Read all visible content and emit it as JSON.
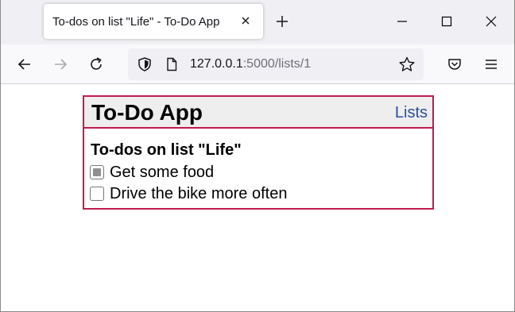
{
  "browser": {
    "tab_title": "To-dos on list \"Life\" - To-Do App",
    "url_host": "127.0.0.1",
    "url_path": ":5000/lists/1"
  },
  "app": {
    "title": "To-Do App",
    "lists_link": "Lists",
    "list_heading": "To-dos on list \"Life\"",
    "todos": [
      {
        "label": "Get some food",
        "state": "indeterminate"
      },
      {
        "label": "Drive the bike more often",
        "state": "unchecked"
      }
    ]
  },
  "colors": {
    "accent_border": "#c01c4e",
    "link": "#2a4f9b",
    "header_bg": "#eeeeee"
  }
}
